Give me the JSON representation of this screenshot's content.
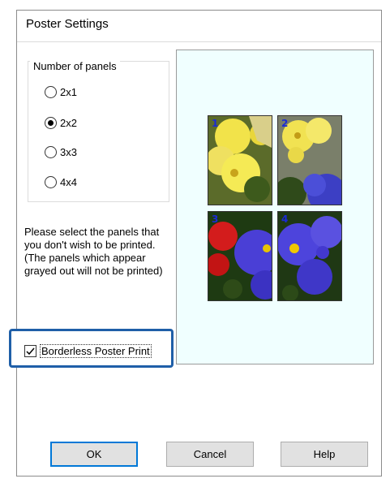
{
  "window": {
    "title": "Poster Settings"
  },
  "panels_group": {
    "legend": "Number of panels",
    "options": [
      {
        "label": "2x1",
        "checked": false
      },
      {
        "label": "2x2",
        "checked": true
      },
      {
        "label": "3x3",
        "checked": false
      },
      {
        "label": "4x4",
        "checked": false
      }
    ]
  },
  "instructions": "Please select the panels that you don't wish to be printed. (The panels which appear grayed out will not be printed)",
  "preview": {
    "panels": [
      {
        "number": "1"
      },
      {
        "number": "2"
      },
      {
        "number": "3"
      },
      {
        "number": "4"
      }
    ]
  },
  "borderless": {
    "label": "Borderless Poster Print",
    "checked": true
  },
  "buttons": {
    "ok": "OK",
    "cancel": "Cancel",
    "help": "Help"
  },
  "colors": {
    "highlight": "#1f5fa8",
    "preview_bg": "#f0ffff",
    "panel_number": "#1b2bd6",
    "default_button_border": "#0078d7"
  }
}
